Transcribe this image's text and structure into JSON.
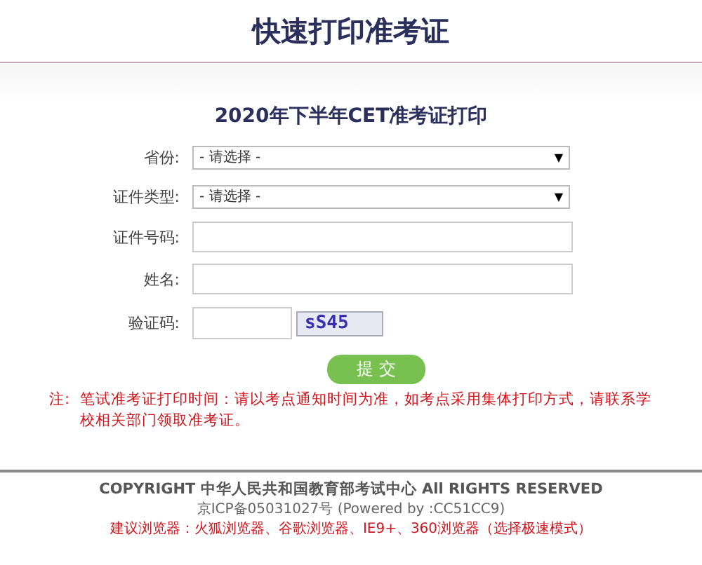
{
  "header": {
    "title": "快速打印准考证"
  },
  "form": {
    "title": "2020年下半年CET准考证打印",
    "fields": [
      {
        "kind": "select",
        "label": "省份:",
        "value": "- 请选择 -",
        "caret": "▼"
      },
      {
        "kind": "select",
        "label": "证件类型:",
        "value": "- 请选择 -",
        "caret": "▼"
      },
      {
        "kind": "input",
        "label": "证件号码:"
      },
      {
        "kind": "input",
        "label": "姓名:"
      },
      {
        "kind": "captcha",
        "label": "验证码:",
        "captcha": "sS45"
      }
    ],
    "submit": "提 交",
    "notice_label": "注:",
    "notice": "笔试准考证打印时间：请以考点通知时间为准，如考点采用集体打印方式，请联系学校相关部门领取准考证。"
  },
  "footer": {
    "copyright": "COPYRIGHT 中华人民共和国教育部考试中心 All RIGHTS RESERVED",
    "icp": "京ICP备05031027号 (Powered by :CC51CC9)",
    "browsers": "建议浏览器：火狐浏览器、谷歌浏览器、IE9+、360浏览器（选择极速模式）"
  }
}
